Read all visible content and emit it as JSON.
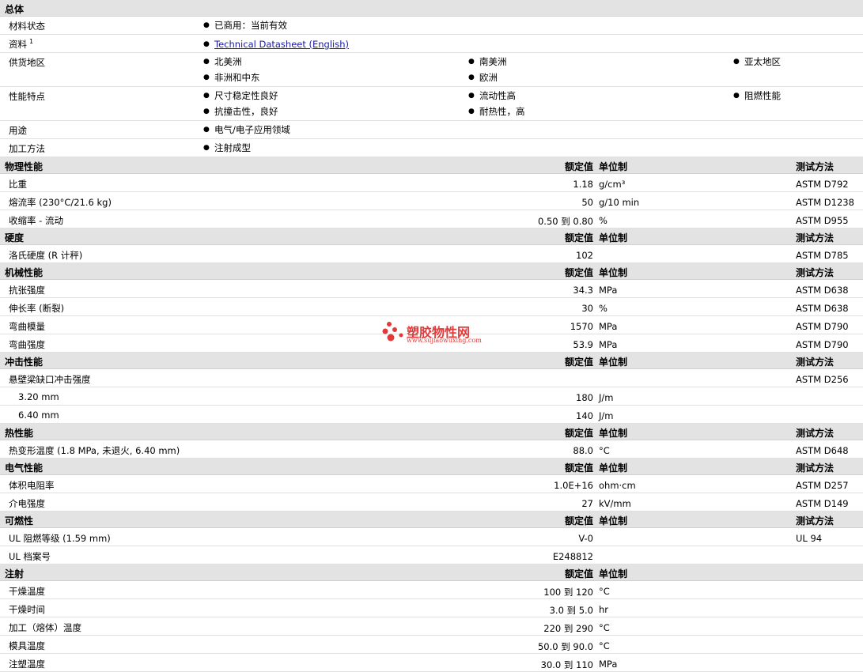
{
  "general": {
    "title": "总体",
    "rows": [
      {
        "label": "材料状态",
        "items": [
          "已商用：当前有效"
        ]
      },
      {
        "label": "资料",
        "sup": "1",
        "link": "Technical Datasheet (English)"
      },
      {
        "label": "供货地区",
        "items": [
          "北美洲",
          "南美洲",
          "亚太地区",
          "非洲和中东",
          "欧洲"
        ]
      },
      {
        "label": "性能特点",
        "items": [
          "尺寸稳定性良好",
          "流动性高",
          "阻燃性能",
          "抗撞击性，良好",
          "耐热性，高"
        ]
      },
      {
        "label": "用途",
        "items": [
          "电气/电子应用领域"
        ]
      },
      {
        "label": "加工方法",
        "items": [
          "注射成型"
        ]
      }
    ]
  },
  "columns": {
    "value": "额定值",
    "unit": "单位制",
    "test": "测试方法"
  },
  "sections": [
    {
      "title": "物理性能",
      "rows": [
        {
          "label": "比重",
          "value": "1.18",
          "unit": "g/cm³",
          "test": "ASTM D792"
        },
        {
          "label": "熔流率 (230°C/21.6 kg)",
          "value": "50",
          "unit": "g/10 min",
          "test": "ASTM D1238"
        },
        {
          "label": "收缩率 - 流动",
          "value": "0.50 到  0.80",
          "unit": "%",
          "test": "ASTM D955"
        }
      ]
    },
    {
      "title": "硬度",
      "rows": [
        {
          "label": "洛氏硬度 (R 计秤)",
          "value": "102",
          "unit": "",
          "test": "ASTM D785"
        }
      ]
    },
    {
      "title": "机械性能",
      "rows": [
        {
          "label": "抗张强度",
          "value": "34.3",
          "unit": "MPa",
          "test": "ASTM D638"
        },
        {
          "label": "伸长率 (断裂)",
          "value": "30",
          "unit": "%",
          "test": "ASTM D638"
        },
        {
          "label": "弯曲模量",
          "value": "1570",
          "unit": "MPa",
          "test": "ASTM D790"
        },
        {
          "label": "弯曲强度",
          "value": "53.9",
          "unit": "MPa",
          "test": "ASTM D790"
        }
      ]
    },
    {
      "title": "冲击性能",
      "rows": [
        {
          "label": "悬壁梁缺口冲击强度",
          "value": "",
          "unit": "",
          "test": "ASTM D256"
        },
        {
          "label": "3.20 mm",
          "sub": true,
          "value": "180",
          "unit": "J/m",
          "test": ""
        },
        {
          "label": "6.40 mm",
          "sub": true,
          "value": "140",
          "unit": "J/m",
          "test": ""
        }
      ]
    },
    {
      "title": "热性能",
      "rows": [
        {
          "label": "热变形温度 (1.8 MPa, 未退火, 6.40 mm)",
          "value": "88.0",
          "unit": "°C",
          "test": "ASTM D648"
        }
      ]
    },
    {
      "title": "电气性能",
      "rows": [
        {
          "label": "体积电阻率",
          "value": "1.0E+16",
          "unit": "ohm·cm",
          "test": "ASTM D257"
        },
        {
          "label": "介电强度",
          "value": "27",
          "unit": "kV/mm",
          "test": "ASTM D149"
        }
      ]
    },
    {
      "title": "可燃性",
      "rows": [
        {
          "label": "UL 阻燃等级 (1.59 mm)",
          "value": "V-0",
          "unit": "",
          "test": "UL 94"
        },
        {
          "label": "UL 档案号",
          "value": "E248812",
          "unit": "",
          "test": ""
        }
      ]
    },
    {
      "title": "注射",
      "noTest": true,
      "rows": [
        {
          "label": "干燥温度",
          "value": "100 到  120",
          "unit": "°C",
          "test": ""
        },
        {
          "label": "干燥时间",
          "value": "3.0 到  5.0",
          "unit": "hr",
          "test": ""
        },
        {
          "label": "加工（熔体）温度",
          "value": "220 到  290",
          "unit": "°C",
          "test": ""
        },
        {
          "label": "模具温度",
          "value": "50.0 到  90.0",
          "unit": "°C",
          "test": ""
        },
        {
          "label": "注塑温度",
          "value": "30.0 到  110",
          "unit": "MPa",
          "test": ""
        }
      ]
    }
  ],
  "watermark": {
    "brand": "塑胶物性网",
    "url": "www.sujiaowuxing.com",
    "color": "#e23a3a"
  }
}
